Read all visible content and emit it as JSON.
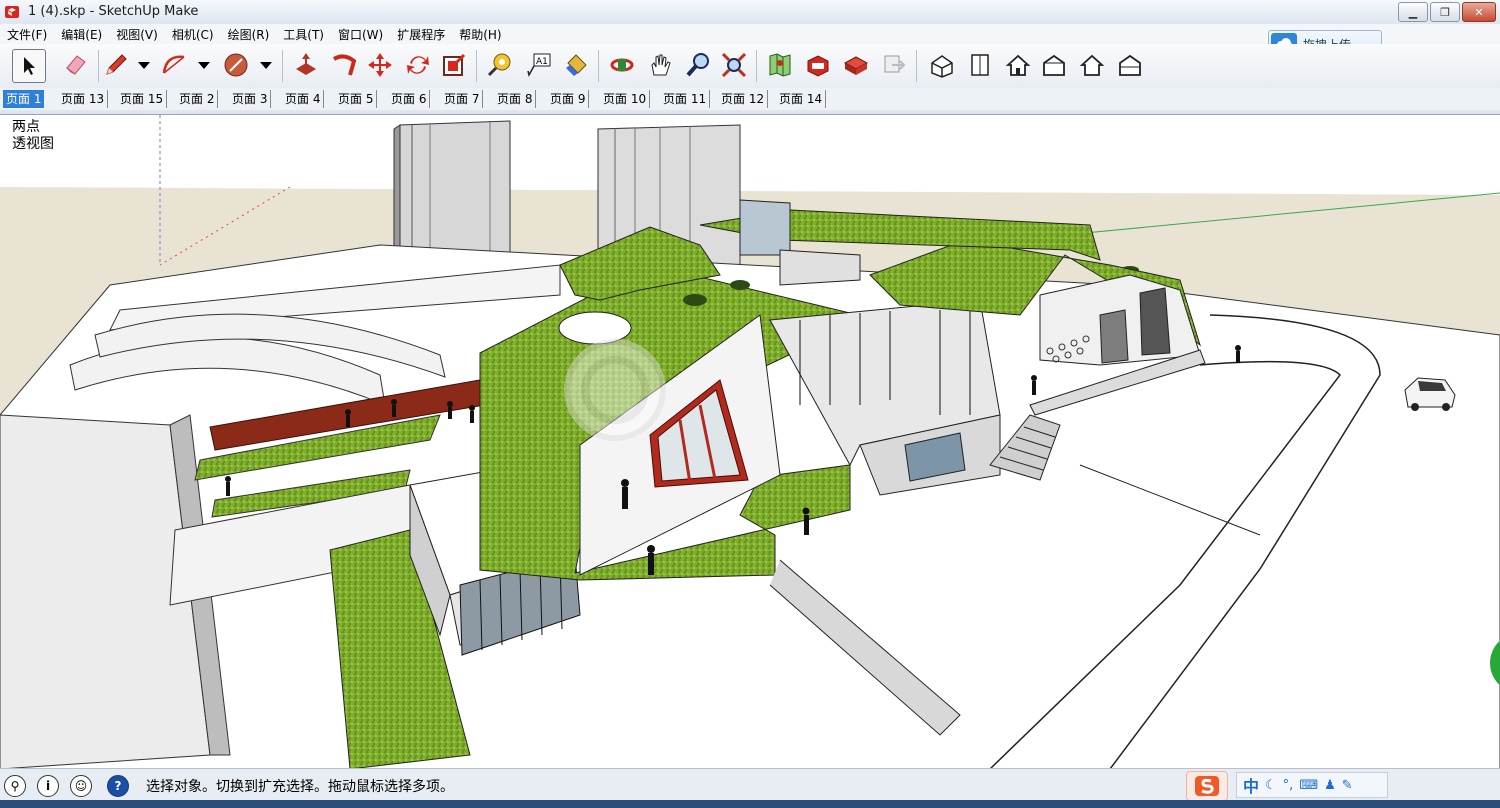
{
  "window": {
    "title": "1 (4).skp - SketchUp Make"
  },
  "menus": [
    "文件(F)",
    "编辑(E)",
    "视图(V)",
    "相机(C)",
    "绘图(R)",
    "工具(T)",
    "窗口(W)",
    "扩展程序",
    "帮助(H)"
  ],
  "upload": {
    "label": "拖拽上传"
  },
  "tabs": [
    "页面 1",
    "页面 13",
    "页面 15",
    "页面 2",
    "页面 3",
    "页面 4",
    "页面 5",
    "页面 6",
    "页面 7",
    "页面 8",
    "页面 9",
    "页面 10",
    "页面 11",
    "页面 12",
    "页面 14"
  ],
  "active_tab": "页面 1",
  "viewport": {
    "camera_line1": "两点",
    "camera_line2": "透视图"
  },
  "status": {
    "message": "选择对象。切换到扩充选择。拖动鼠标选择多项。"
  },
  "ime": {
    "zh_label": "中"
  },
  "tools": [
    "select-icon",
    "eraser-icon",
    "pencil-icon",
    "arc-icon",
    "shape-icon",
    "push-pull-icon",
    "follow-me-icon",
    "move-icon",
    "rotate-icon",
    "scale-icon",
    "tape-measure-icon",
    "text-icon",
    "paint-bucket-icon",
    "orbit-icon",
    "pan-icon",
    "zoom-icon",
    "zoom-extents-icon",
    "map-icon",
    "warehouse-icon",
    "components-icon",
    "layout-icon",
    "iso-view-icon",
    "top-view-icon",
    "front-view-icon",
    "right-view-icon",
    "back-view-icon",
    "left-view-icon"
  ]
}
